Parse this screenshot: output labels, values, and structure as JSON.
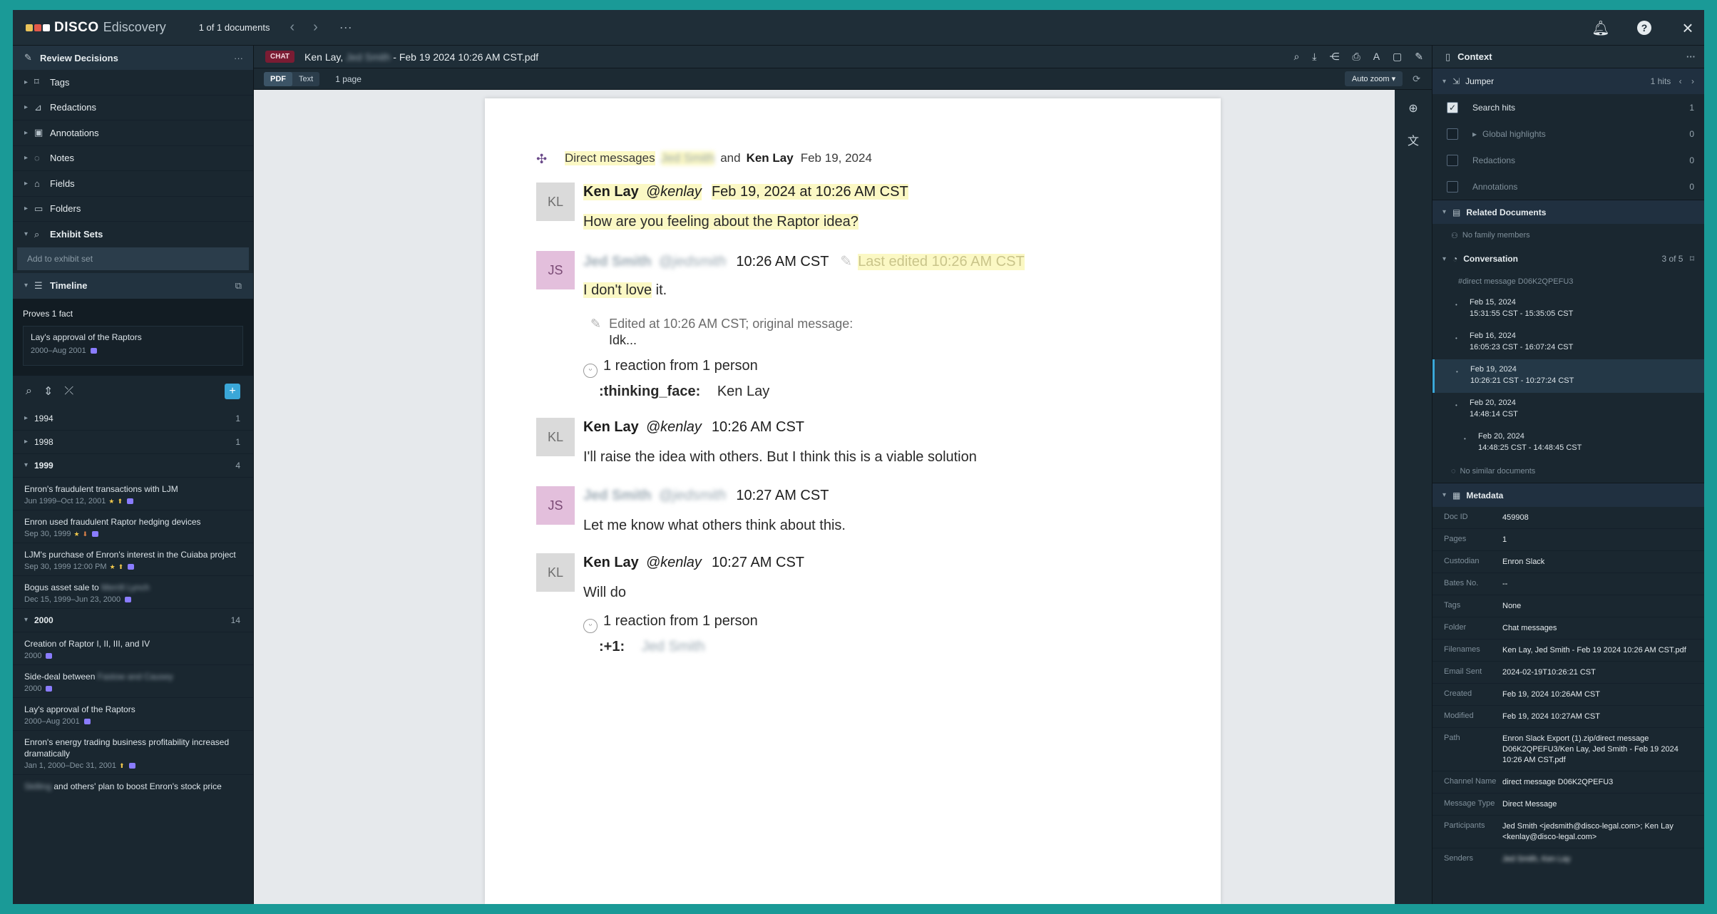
{
  "topbar": {
    "brand": "DISCO",
    "brand_sub": "Ediscovery",
    "doc_count": "1 of 1 documents",
    "logo_colors": [
      "#e8c35a",
      "#e35a4a",
      "#ffffff"
    ]
  },
  "left": {
    "header": "Review Decisions",
    "sections": [
      {
        "label": "Tags",
        "icon": "tag-icon"
      },
      {
        "label": "Redactions",
        "icon": "redaction-icon"
      },
      {
        "label": "Annotations",
        "icon": "annotation-icon"
      },
      {
        "label": "Notes",
        "icon": "note-icon"
      },
      {
        "label": "Fields",
        "icon": "field-icon"
      },
      {
        "label": "Folders",
        "icon": "folder-icon"
      },
      {
        "label": "Exhibit Sets",
        "icon": "exhibit-icon"
      }
    ],
    "exhibit_placeholder": "Add to exhibit set",
    "timeline": "Timeline",
    "proves": "Proves 1 fact",
    "fact": {
      "title": "Lay's approval of the Raptors",
      "date": "2000–Aug 2001"
    },
    "years": [
      {
        "year": "1994",
        "count": "1"
      },
      {
        "year": "1998",
        "count": "1"
      },
      {
        "year": "1999",
        "count": "4"
      }
    ],
    "events_1999": [
      {
        "title": "Enron's fraudulent transactions with LJM",
        "date": "Jun 1999–Oct 12, 2001"
      },
      {
        "title": "Enron used fraudulent Raptor hedging devices",
        "date": "Sep 30, 1999"
      },
      {
        "title": "LJM's purchase of Enron's interest in the Cuiaba project",
        "date": "Sep 30, 1999 12:00 PM"
      },
      {
        "title": "Bogus asset sale to",
        "title_blur": "Merrill Lynch",
        "date": "Dec 15, 1999–Jun 23, 2000"
      }
    ],
    "year_2000": {
      "year": "2000",
      "count": "14"
    },
    "events_2000": [
      {
        "title": "Creation of Raptor I, II, III, and IV",
        "date": "2000"
      },
      {
        "title": "Side-deal between",
        "title_blur": "Fastow and Causey",
        "date": "2000"
      },
      {
        "title": "Lay's approval of the Raptors",
        "date": "2000–Aug 2001"
      },
      {
        "title": "Enron's energy trading business profitability increased dramatically",
        "date": "Jan 1, 2000–Dec 31, 2001"
      },
      {
        "title_blur": "Skilling",
        "title": "and others' plan to boost Enron's stock price",
        "date": ""
      }
    ]
  },
  "center": {
    "badge": "CHAT",
    "title_prefix": "Ken Lay,",
    "title_blur": "Jed Smith",
    "title_suffix": "- Feb 19 2024 10:26 AM CST.pdf",
    "tab_pdf": "PDF",
    "tab_text": "Text",
    "pages": "1 page",
    "zoom": "Auto zoom",
    "doc": {
      "header_prefix": "Direct messages",
      "header_blur": "Jed Smith",
      "header_and": "and",
      "header_name": "Ken Lay",
      "header_date": "Feb 19, 2024",
      "messages": [
        {
          "initials": "KL",
          "name": "Ken Lay",
          "handle": "@kenlay",
          "time": "Feb 19, 2024 at 10:26 AM CST",
          "body": "How are you feeling about the Raptor idea?"
        },
        {
          "initials": "JS",
          "name": "Jed Smith",
          "handle": "@jedsmith",
          "time": "10:26 AM CST",
          "edited_note": "Last edited 10:26 AM CST",
          "body_hl": "I don't love",
          "body_rest": " it.",
          "edit_line": "Edited at 10:26 AM CST; original message:",
          "edit_orig": "Idk...",
          "reaction": "1 reaction from 1 person",
          "react_code": ":thinking_face:",
          "react_by": "Ken Lay"
        },
        {
          "initials": "KL",
          "name": "Ken Lay",
          "handle": "@kenlay",
          "time": "10:26 AM CST",
          "body": "I'll raise the idea with others. But I think this is a viable solution"
        },
        {
          "initials": "JS",
          "name": "Jed Smith",
          "handle": "@jedsmith",
          "time": "10:27 AM CST",
          "body": "Let me know what others think about this."
        },
        {
          "initials": "KL",
          "name": "Ken Lay",
          "handle": "@kenlay",
          "time": "10:27 AM CST",
          "body": "Will do",
          "reaction": "1 reaction from 1 person",
          "react_code": ":+1:",
          "react_by": "Jed Smith"
        }
      ]
    }
  },
  "right": {
    "header": "Context",
    "jumper": "Jumper",
    "hits": "1 hits",
    "jumper_rows": [
      {
        "label": "Search hits",
        "count": "1",
        "checked": true
      },
      {
        "label": "Global highlights",
        "count": "0",
        "checked": false
      },
      {
        "label": "Redactions",
        "count": "0",
        "checked": false
      },
      {
        "label": "Annotations",
        "count": "0",
        "checked": false
      }
    ],
    "related": "Related Documents",
    "no_family": "No family members",
    "conversation": "Conversation",
    "conv_count": "3 of 5",
    "conv_tag": "#direct message D06K2QPEFU3",
    "conv_items": [
      {
        "date": "Feb 15, 2024",
        "range": "15:31:55 CST - 15:35:05 CST"
      },
      {
        "date": "Feb 16, 2024",
        "range": "16:05:23 CST - 16:07:24 CST"
      },
      {
        "date": "Feb 19, 2024",
        "range": "10:26:21 CST - 10:27:24 CST"
      },
      {
        "date": "Feb 20, 2024",
        "range": "14:48:14 CST"
      },
      {
        "date": "Feb 20, 2024",
        "range": "14:48:25 CST - 14:48:45 CST"
      }
    ],
    "no_similar": "No similar documents",
    "metadata": "Metadata",
    "meta": [
      {
        "key": "Doc ID",
        "val": "459908"
      },
      {
        "key": "Pages",
        "val": "1"
      },
      {
        "key": "Custodian",
        "val": "Enron Slack"
      },
      {
        "key": "Bates No.",
        "val": "--"
      },
      {
        "key": "Tags",
        "val": "None"
      },
      {
        "key": "Folder",
        "val": "Chat messages"
      },
      {
        "key": "Filenames",
        "val": "Ken Lay, Jed Smith - Feb 19 2024 10:26 AM CST.pdf"
      },
      {
        "key": "Email Sent",
        "val": "2024-02-19T10:26:21 CST"
      },
      {
        "key": "Created",
        "val": "Feb 19, 2024 10:26AM CST"
      },
      {
        "key": "Modified",
        "val": "Feb 19, 2024 10:27AM CST"
      },
      {
        "key": "Path",
        "val": "Enron Slack Export (1).zip/direct message D06K2QPEFU3/Ken Lay, Jed Smith - Feb 19 2024 10:26 AM CST.pdf"
      },
      {
        "key": "Channel Name",
        "val": "direct message D06K2QPEFU3"
      },
      {
        "key": "Message Type",
        "val": "Direct Message"
      },
      {
        "key": "Participants",
        "val": "Jed Smith <jedsmith@disco-legal.com>; Ken Lay <kenlay@disco-legal.com>"
      },
      {
        "key": "Senders",
        "val": "Jed Smith, Ken Lay"
      }
    ]
  }
}
